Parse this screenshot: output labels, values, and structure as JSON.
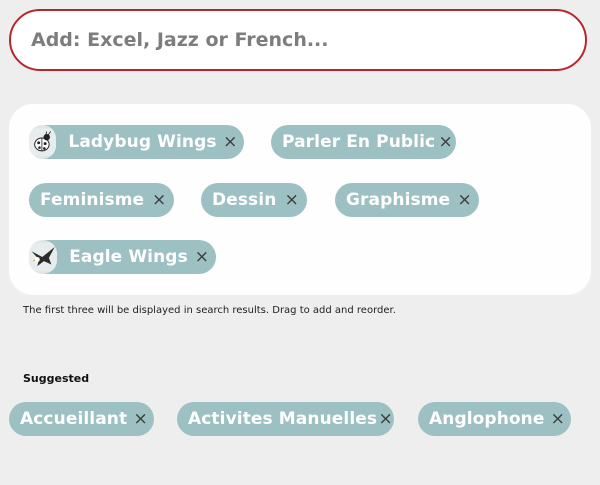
{
  "search": {
    "placeholder": "Add: Excel, Jazz or French..."
  },
  "selected_tags": [
    {
      "label": "Ladybug Wings",
      "icon": "ladybug-icon"
    },
    {
      "label": "Parler En Public"
    },
    {
      "label": "Feminisme"
    },
    {
      "label": "Dessin"
    },
    {
      "label": "Graphisme"
    },
    {
      "label": "Eagle Wings",
      "icon": "eagle-icon"
    }
  ],
  "remove_glyph": "×",
  "hint_text": "The first three will be displayed in search results. Drag to add and reorder.",
  "suggested": {
    "title": "Suggested",
    "tags": [
      {
        "label": "Accueillant"
      },
      {
        "label": "Activites Manuelles"
      },
      {
        "label": "Anglophone"
      }
    ]
  },
  "colors": {
    "background": "#efeeef",
    "search_border": "#b8262c",
    "tag_background": "#9dc0c3",
    "tag_text": "#ffffff"
  }
}
